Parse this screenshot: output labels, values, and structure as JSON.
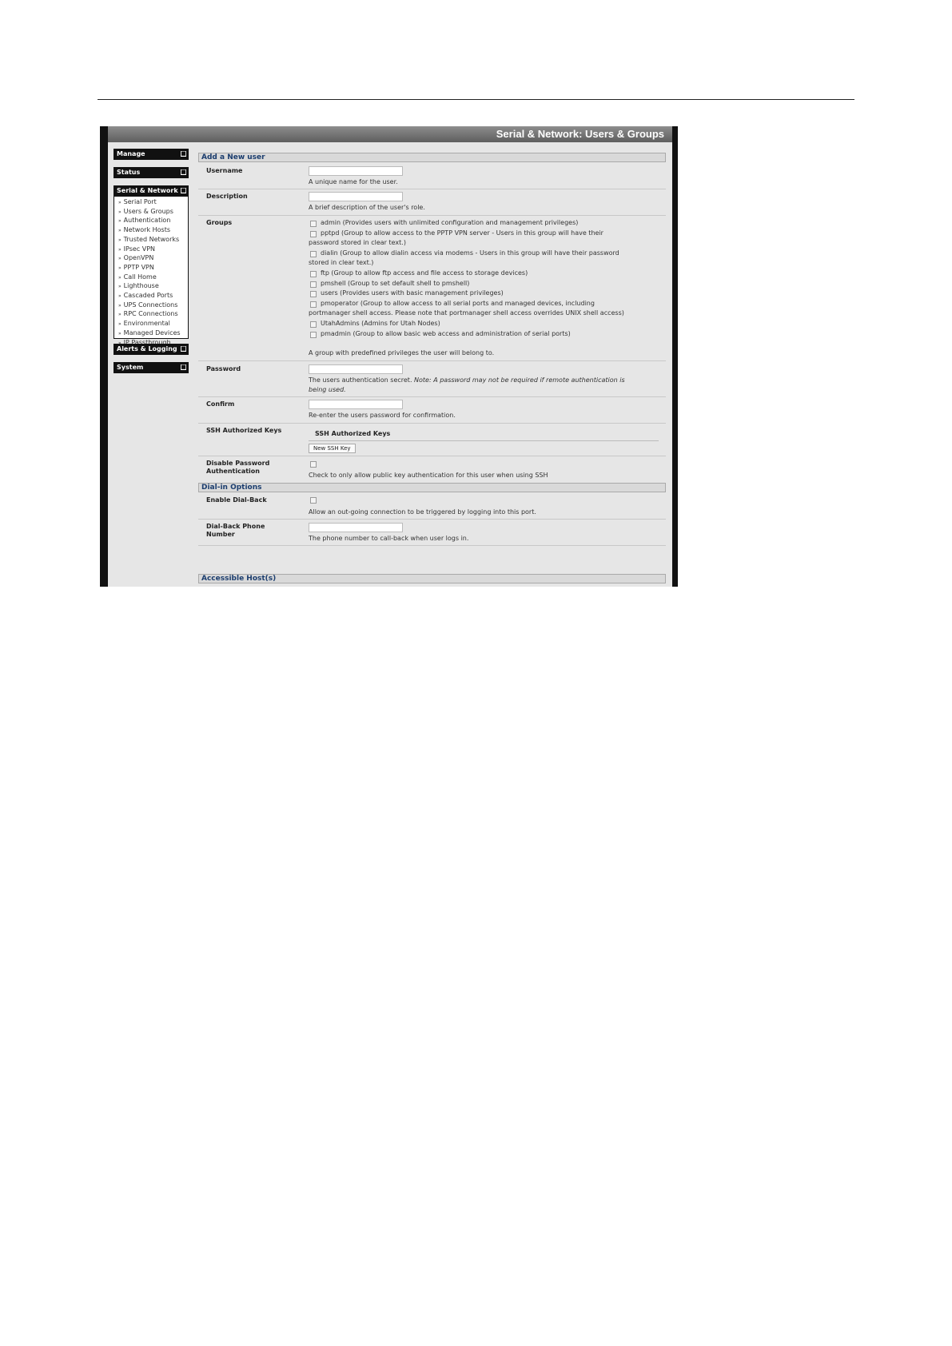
{
  "window": {
    "title": "Serial & Network: Users & Groups"
  },
  "nav": {
    "manage": "Manage",
    "status": "Status",
    "serial_network": "Serial & Network",
    "items": [
      "Serial Port",
      "Users & Groups",
      "Authentication",
      "Network Hosts",
      "Trusted Networks",
      "IPsec VPN",
      "OpenVPN",
      "PPTP VPN",
      "Call Home",
      "Lighthouse",
      "Cascaded Ports",
      "UPS Connections",
      "RPC Connections",
      "Environmental",
      "Managed Devices",
      "IP Passthrough"
    ],
    "alerts_logging": "Alerts & Logging",
    "system": "System",
    "toggle": "■"
  },
  "sections": {
    "add_user": "Add a New user",
    "dialin": "Dial-in Options",
    "accessible_hosts": "Accessible Host(s)"
  },
  "form": {
    "username": {
      "label": "Username",
      "value": "",
      "help": "A unique name for the user."
    },
    "description": {
      "label": "Description",
      "value": "",
      "help": "A brief description of the user's role."
    },
    "groups": {
      "label": "Groups",
      "lines": [
        "admin (Provides users with unlimited configuration and management privileges)",
        "pptpd (Group to allow access to the PPTP VPN server - Users in this group will have their",
        "password stored in clear text.)",
        "dialin (Group to allow dialin access via modems - Users in this group will have their password",
        "stored in clear text.)",
        "ftp (Group to allow ftp access and file access to storage devices)",
        "pmshell (Group to set default shell to pmshell)",
        "users (Provides users with basic management privileges)",
        "pmoperator (Group to allow access to all serial ports and managed devices, including",
        "portmanager shell access. Please note that portmanager shell access overrides UNIX shell access)",
        "UtahAdmins (Admins for Utah Nodes)",
        "pmadmin (Group to allow basic web access and administration of serial ports)"
      ],
      "help": "A group with predefined privileges the user will belong to."
    },
    "password": {
      "label": "Password",
      "value": "",
      "help": "The users authentication secret.",
      "note": "Note: A password may not be required if remote authentication is",
      "note2": "being used."
    },
    "confirm": {
      "label": "Confirm",
      "value": "",
      "help": "Re-enter the users password for confirmation."
    },
    "ssh": {
      "label": "SSH Authorized Keys",
      "title": "SSH Authorized Keys",
      "button": "New SSH Key"
    },
    "disable_pw": {
      "label1": "Disable Password",
      "label2": "Authentication",
      "help": "Check to only allow public key authentication for this user when using SSH"
    },
    "dialback": {
      "label": "Enable Dial-Back",
      "help": "Allow an out-going connection to be triggered by logging into this port."
    },
    "dialback_phone": {
      "label1": "Dial-Back Phone",
      "label2": "Number",
      "value": "",
      "help": "The phone number to call-back when user logs in."
    }
  }
}
